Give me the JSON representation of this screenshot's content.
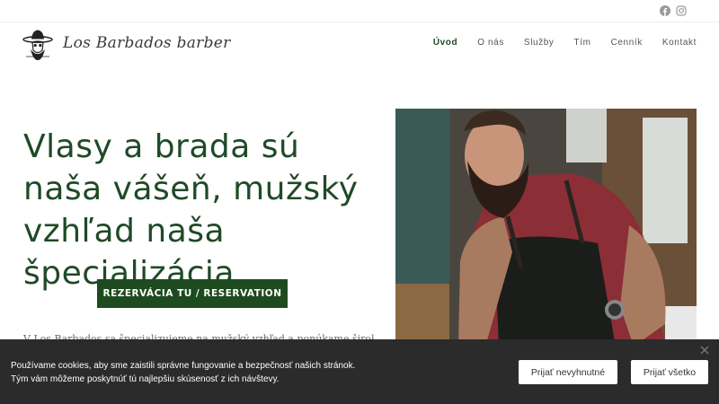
{
  "topbar": {
    "social_icons": [
      "facebook-icon",
      "instagram-icon"
    ]
  },
  "header": {
    "logo_text": "Los Barbados barber",
    "nav": [
      {
        "label": "Úvod",
        "active": true
      },
      {
        "label": "O nás",
        "active": false
      },
      {
        "label": "Služby",
        "active": false
      },
      {
        "label": "Tím",
        "active": false
      },
      {
        "label": "Cenník",
        "active": false
      },
      {
        "label": "Kontakt",
        "active": false
      }
    ]
  },
  "hero": {
    "title": "Vlasy a brada sú naša vášeň, mužský vzhľad naša špecializácia.",
    "cta_label": "REZERVÁCIA TU / RESERVATION",
    "intro": "V Los Barbados sa špecializujeme na mužský vzhľad a ponúkame širokú škálu"
  },
  "cookie": {
    "text": "Používame cookies, aby sme zaistili správne fungovanie a bezpečnosť našich stránok. Tým vám môžeme poskytnúť tú najlepšiu skúsenosť z ich návštevy.",
    "accept_necessary": "Prijať nevyhnutné",
    "accept_all": "Prijať všetko"
  },
  "colors": {
    "brand_green": "#1e4a20",
    "cookie_bg": "#2b2b2b"
  }
}
